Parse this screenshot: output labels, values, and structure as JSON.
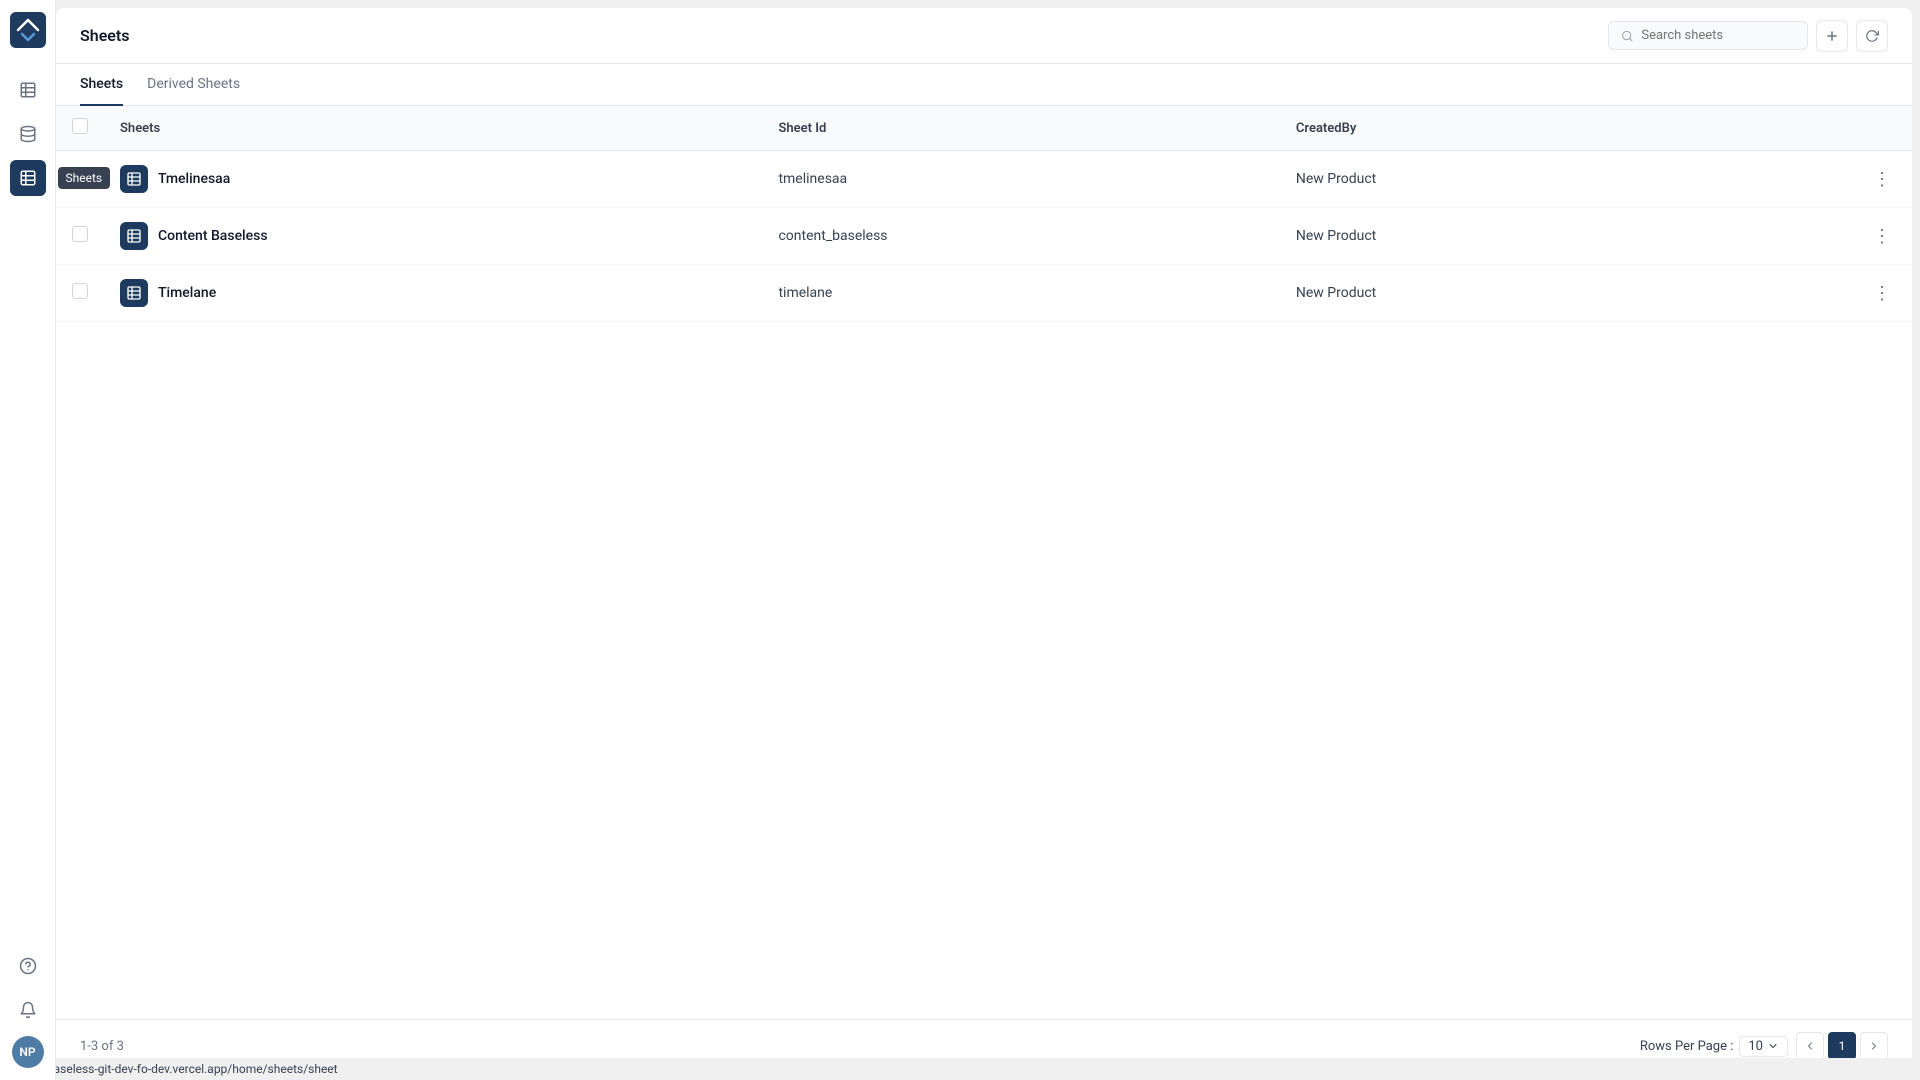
{
  "app": {
    "title": "Sheets"
  },
  "header": {
    "title": "Sheets",
    "search_placeholder": "Search sheets",
    "add_label": "+",
    "refresh_label": "↻"
  },
  "tabs": [
    {
      "id": "sheets",
      "label": "Sheets",
      "active": true
    },
    {
      "id": "derived-sheets",
      "label": "Derived Sheets",
      "active": false
    }
  ],
  "table": {
    "columns": [
      {
        "id": "checkbox",
        "label": ""
      },
      {
        "id": "name",
        "label": "Sheets"
      },
      {
        "id": "sheet_id",
        "label": "Sheet Id"
      },
      {
        "id": "created_by",
        "label": "CreatedBy"
      },
      {
        "id": "actions",
        "label": ""
      }
    ],
    "rows": [
      {
        "id": 1,
        "name": "Tmelinesaa",
        "sheet_id": "tmelinesaa",
        "created_by": "New Product"
      },
      {
        "id": 2,
        "name": "Content Baseless",
        "sheet_id": "content_baseless",
        "created_by": "New Product"
      },
      {
        "id": 3,
        "name": "Timelane",
        "sheet_id": "timelane",
        "created_by": "New Product"
      }
    ]
  },
  "footer": {
    "pagination_info": "1-3 of 3",
    "rows_per_page_label": "Rows Per Page :",
    "rows_per_page_value": "10",
    "current_page": "1"
  },
  "sidebar": {
    "logo_initials": "NP",
    "tooltip": "Sheets",
    "nav_items": [
      {
        "id": "table",
        "icon": "table-icon"
      },
      {
        "id": "database",
        "icon": "database-icon"
      },
      {
        "id": "sheets",
        "icon": "sheets-icon",
        "active": true
      }
    ],
    "bottom_items": [
      {
        "id": "help",
        "icon": "help-icon"
      },
      {
        "id": "notifications",
        "icon": "bell-icon"
      }
    ],
    "avatar_initials": "NP"
  },
  "status_bar": {
    "url": "https://baseless-git-dev-fo-dev.vercel.app/home/sheets/sheet"
  }
}
